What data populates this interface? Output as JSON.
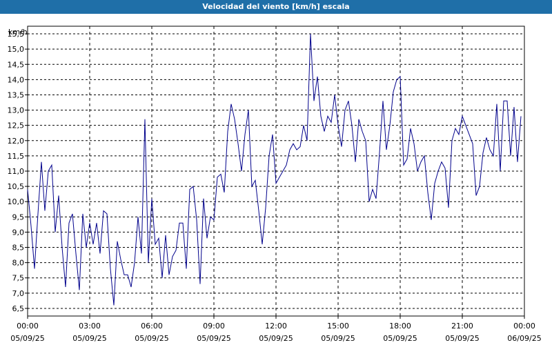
{
  "window": {
    "title": "Velocidad del viento [km/h] escala"
  },
  "chart_data": {
    "type": "line",
    "title": "Velocidad del viento [km/h] escala",
    "ylabel": "km/h",
    "xlabel": "",
    "ylim": [
      6.25,
      15.75
    ],
    "grid": true,
    "y_ticks": [
      "6,5",
      "7,0",
      "7,5",
      "8,0",
      "8,5",
      "9,0",
      "9,5",
      "10,0",
      "10,5",
      "11,0",
      "11,5",
      "12,0",
      "12,5",
      "13,0",
      "13,5",
      "14,0",
      "14,5",
      "15,0",
      "15,5"
    ],
    "x_ticks": [
      {
        "time": "00:00",
        "date": "05/09/25"
      },
      {
        "time": "03:00",
        "date": "05/09/25"
      },
      {
        "time": "06:00",
        "date": "05/09/25"
      },
      {
        "time": "09:00",
        "date": "05/09/25"
      },
      {
        "time": "12:00",
        "date": "05/09/25"
      },
      {
        "time": "15:00",
        "date": "05/09/25"
      },
      {
        "time": "18:00",
        "date": "05/09/25"
      },
      {
        "time": "21:00",
        "date": "05/09/25"
      },
      {
        "time": "00:00",
        "date": "06/09/25"
      }
    ],
    "series": [
      {
        "color": "#00008b",
        "x": [
          "05/09/25 00:00",
          "05/09/25 00:10",
          "05/09/25 00:20",
          "05/09/25 00:30",
          "05/09/25 00:40",
          "05/09/25 00:50",
          "05/09/25 01:00",
          "05/09/25 01:10",
          "05/09/25 01:20",
          "05/09/25 01:30",
          "05/09/25 01:40",
          "05/09/25 01:50",
          "05/09/25 02:00",
          "05/09/25 02:10",
          "05/09/25 02:20",
          "05/09/25 02:30",
          "05/09/25 02:40",
          "05/09/25 02:50",
          "05/09/25 03:00",
          "05/09/25 03:10",
          "05/09/25 03:20",
          "05/09/25 03:30",
          "05/09/25 03:40",
          "05/09/25 03:50",
          "05/09/25 04:00",
          "05/09/25 04:10",
          "05/09/25 04:20",
          "05/09/25 04:30",
          "05/09/25 04:40",
          "05/09/25 04:50",
          "05/09/25 05:00",
          "05/09/25 05:10",
          "05/09/25 05:20",
          "05/09/25 05:30",
          "05/09/25 05:40",
          "05/09/25 05:50",
          "05/09/25 06:00",
          "05/09/25 06:10",
          "05/09/25 06:20",
          "05/09/25 06:30",
          "05/09/25 06:40",
          "05/09/25 06:50",
          "05/09/25 07:00",
          "05/09/25 07:10",
          "05/09/25 07:20",
          "05/09/25 07:30",
          "05/09/25 07:40",
          "05/09/25 07:50",
          "05/09/25 08:00",
          "05/09/25 08:10",
          "05/09/25 08:20",
          "05/09/25 08:30",
          "05/09/25 08:40",
          "05/09/25 08:50",
          "05/09/25 09:00",
          "05/09/25 09:10",
          "05/09/25 09:20",
          "05/09/25 09:30",
          "05/09/25 09:40",
          "05/09/25 09:50",
          "05/09/25 10:00",
          "05/09/25 10:10",
          "05/09/25 10:20",
          "05/09/25 10:30",
          "05/09/25 10:40",
          "05/09/25 10:50",
          "05/09/25 11:00",
          "05/09/25 11:10",
          "05/09/25 11:20",
          "05/09/25 11:30",
          "05/09/25 11:40",
          "05/09/25 11:50",
          "05/09/25 12:00",
          "05/09/25 12:10",
          "05/09/25 12:20",
          "05/09/25 12:30",
          "05/09/25 12:40",
          "05/09/25 12:50",
          "05/09/25 13:00",
          "05/09/25 13:10",
          "05/09/25 13:20",
          "05/09/25 13:30",
          "05/09/25 13:40",
          "05/09/25 13:50",
          "05/09/25 14:00",
          "05/09/25 14:10",
          "05/09/25 14:20",
          "05/09/25 14:30",
          "05/09/25 14:40",
          "05/09/25 14:50",
          "05/09/25 15:00",
          "05/09/25 15:10",
          "05/09/25 15:20",
          "05/09/25 15:30",
          "05/09/25 15:40",
          "05/09/25 15:50",
          "05/09/25 16:00",
          "05/09/25 16:10",
          "05/09/25 16:20",
          "05/09/25 16:30",
          "05/09/25 16:40",
          "05/09/25 16:50",
          "05/09/25 17:00",
          "05/09/25 17:10",
          "05/09/25 17:20",
          "05/09/25 17:30",
          "05/09/25 17:40",
          "05/09/25 17:50",
          "05/09/25 18:00",
          "05/09/25 18:10",
          "05/09/25 18:20",
          "05/09/25 18:30",
          "05/09/25 18:40",
          "05/09/25 18:50",
          "05/09/25 19:00",
          "05/09/25 19:10",
          "05/09/25 19:20",
          "05/09/25 19:30",
          "05/09/25 19:40",
          "05/09/25 19:50",
          "05/09/25 20:00",
          "05/09/25 20:10",
          "05/09/25 20:20",
          "05/09/25 20:30",
          "05/09/25 20:40",
          "05/09/25 20:50",
          "05/09/25 21:00",
          "05/09/25 21:10",
          "05/09/25 21:20",
          "05/09/25 21:30",
          "05/09/25 21:40",
          "05/09/25 21:50",
          "05/09/25 22:00",
          "05/09/25 22:10",
          "05/09/25 22:20",
          "05/09/25 22:30",
          "05/09/25 22:40",
          "05/09/25 22:50",
          "05/09/25 23:00",
          "05/09/25 23:10",
          "05/09/25 23:20",
          "05/09/25 23:30",
          "05/09/25 23:40",
          "05/09/25 23:50"
        ],
        "y": [
          10.4,
          9.2,
          7.8,
          9.6,
          11.3,
          9.7,
          11.0,
          11.2,
          9.0,
          10.2,
          8.5,
          7.2,
          9.3,
          9.6,
          8.3,
          7.1,
          9.6,
          8.5,
          9.3,
          8.6,
          9.3,
          8.3,
          9.7,
          9.6,
          7.8,
          6.6,
          8.7,
          8.1,
          7.6,
          7.6,
          7.2,
          8.0,
          9.5,
          8.3,
          12.7,
          8.0,
          10.1,
          8.6,
          8.8,
          7.5,
          8.9,
          7.6,
          8.2,
          8.4,
          9.3,
          9.3,
          7.8,
          10.4,
          10.5,
          9.4,
          7.3,
          10.1,
          8.8,
          9.5,
          9.4,
          10.8,
          10.9,
          10.3,
          12.3,
          13.2,
          12.7,
          11.9,
          11.0,
          12.2,
          13.0,
          10.5,
          10.7,
          9.7,
          8.6,
          9.8,
          11.5,
          12.2,
          10.6,
          10.8,
          11.0,
          11.2,
          11.7,
          11.9,
          11.7,
          11.8,
          12.5,
          12.0,
          15.5,
          13.3,
          14.1,
          12.8,
          12.3,
          12.8,
          12.6,
          13.5,
          12.5,
          11.8,
          13.0,
          13.3,
          12.5,
          11.3,
          12.7,
          12.3,
          12.0,
          10.0,
          10.4,
          10.1,
          11.6,
          13.3,
          11.7,
          12.5,
          13.6,
          14.0,
          14.1,
          11.2,
          11.4,
          12.4,
          11.9,
          11.0,
          11.3,
          11.5,
          10.3,
          9.4,
          10.6,
          11.0,
          11.3,
          11.1,
          9.8,
          12.0,
          12.4,
          12.2,
          12.8,
          12.5,
          12.2,
          11.9,
          10.2,
          10.5,
          11.6,
          12.1,
          11.7,
          11.5,
          13.2,
          11.0,
          13.3,
          13.3,
          11.5,
          13.1,
          11.3,
          12.8
        ]
      }
    ]
  }
}
